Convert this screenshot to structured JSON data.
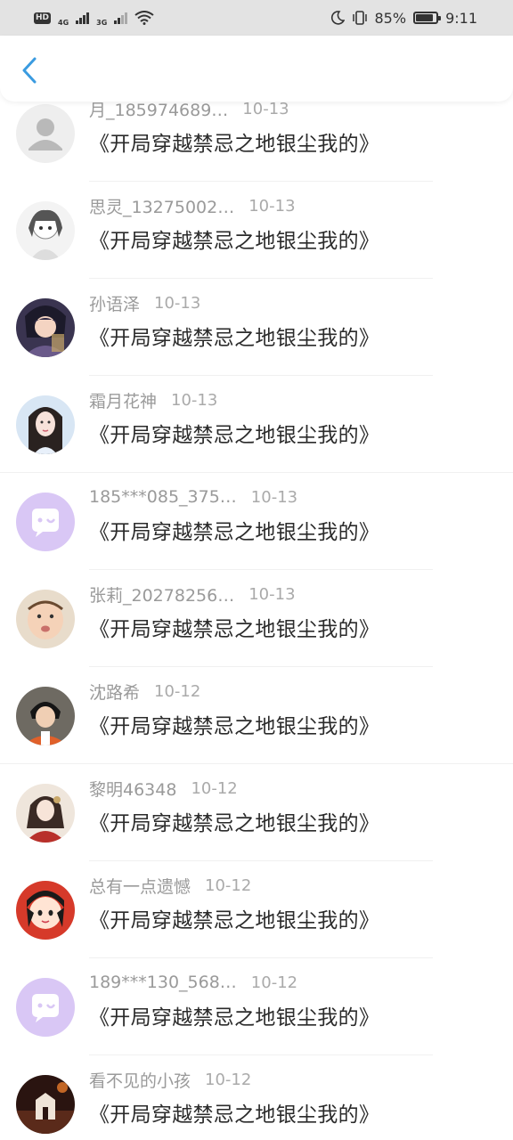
{
  "status_bar": {
    "left_indicators": [
      "HD",
      "4G",
      "3G"
    ],
    "battery": "85%",
    "time": "9:11",
    "battery_level": 0.85
  },
  "header": {
    "back_icon": "chevron-left-icon",
    "accent": "#3a9be0"
  },
  "list": {
    "items": [
      {
        "name": "月_185974689…",
        "date": "10-13",
        "message": "《开局穿越禁忌之地银尘我的》",
        "avatar": "default-person"
      },
      {
        "name": "思灵_13275002…",
        "date": "10-13",
        "message": "《开局穿越禁忌之地银尘我的》",
        "avatar": "photo-sketch"
      },
      {
        "name": "孙语泽",
        "date": "10-13",
        "message": "《开局穿越禁忌之地银尘我的》",
        "avatar": "photo-anime"
      },
      {
        "name": "霜月花神",
        "date": "10-13",
        "message": "《开局穿越禁忌之地银尘我的》",
        "avatar": "photo-woman"
      },
      {
        "name": "185***085_375…",
        "date": "10-13",
        "message": "《开局穿越禁忌之地银尘我的》",
        "avatar": "default-chat"
      },
      {
        "name": "张莉_20278256…",
        "date": "10-13",
        "message": "《开局穿越禁忌之地银尘我的》",
        "avatar": "photo-baby"
      },
      {
        "name": "沈路希",
        "date": "10-12",
        "message": "《开局穿越禁忌之地银尘我的》",
        "avatar": "photo-boy"
      },
      {
        "name": "黎明46348",
        "date": "10-12",
        "message": "《开局穿越禁忌之地银尘我的》",
        "avatar": "photo-painting"
      },
      {
        "name": "总有一点遗憾",
        "date": "10-12",
        "message": "《开局穿越禁忌之地银尘我的》",
        "avatar": "photo-cartoon"
      },
      {
        "name": "189***130_568…",
        "date": "10-12",
        "message": "《开局穿越禁忌之地银尘我的》",
        "avatar": "default-chat"
      },
      {
        "name": "看不见的小孩",
        "date": "10-12",
        "message": "《开局穿越禁忌之地银尘我的》",
        "avatar": "photo-dark"
      }
    ]
  },
  "colors": {
    "status_bg": "#e3e3e3",
    "default_avatar_purple": "#d9c7f5",
    "default_avatar_grey": "#eeeeee",
    "name_text": "#9a9a9a",
    "message_text": "#2b2b2b"
  }
}
